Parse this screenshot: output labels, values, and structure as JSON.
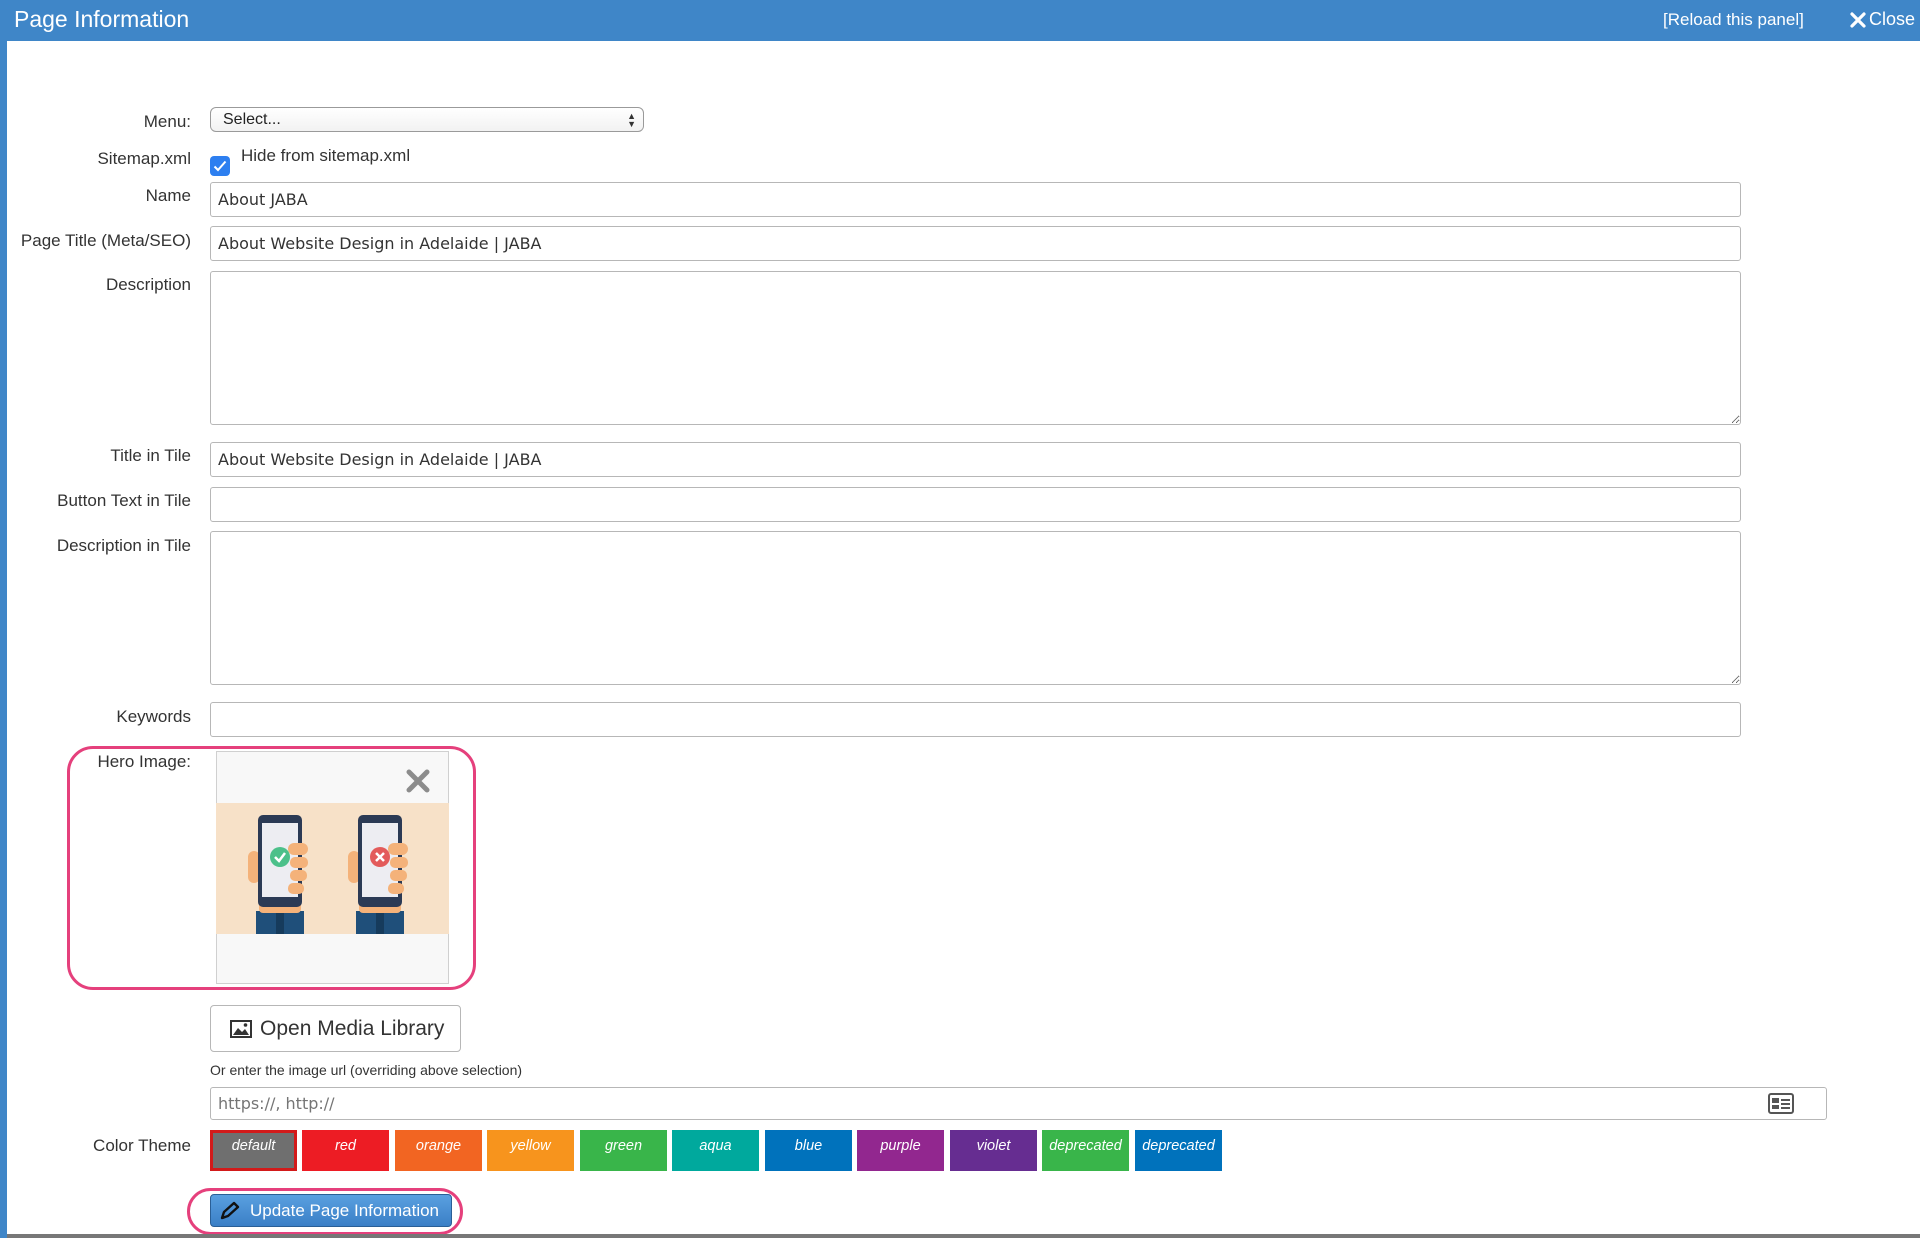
{
  "window": {
    "title": "Page Information",
    "reload_label": "[Reload this panel]",
    "close_label": "Close"
  },
  "form": {
    "menu": {
      "label": "Menu:",
      "value": "Select..."
    },
    "sitemap": {
      "label": "Sitemap.xml",
      "checkbox_label": "Hide from sitemap.xml",
      "checked": true
    },
    "name": {
      "label": "Name",
      "value": "About JABA"
    },
    "page_title": {
      "label": "Page Title (Meta/SEO)",
      "value": "About Website Design in Adelaide | JABA"
    },
    "description": {
      "label": "Description",
      "value": ""
    },
    "title_in_tile": {
      "label": "Title in Tile",
      "value": "About Website Design in Adelaide | JABA"
    },
    "button_text_in_tile": {
      "label": "Button Text in Tile",
      "value": ""
    },
    "description_in_tile": {
      "label": "Description in Tile",
      "value": ""
    },
    "keywords": {
      "label": "Keywords",
      "value": ""
    },
    "hero_image": {
      "label": "Hero Image:",
      "media_button": "Open Media Library",
      "url_note": "Or enter the image url (overriding above selection)",
      "url_placeholder": "https://, http://"
    },
    "color_theme": {
      "label": "Color Theme",
      "selected": "default",
      "options": [
        {
          "name": "default",
          "color": "#6f6f6f"
        },
        {
          "name": "red",
          "color": "#ed1c24"
        },
        {
          "name": "orange",
          "color": "#f26522"
        },
        {
          "name": "yellow",
          "color": "#f7941d"
        },
        {
          "name": "green",
          "color": "#39b54a"
        },
        {
          "name": "aqua",
          "color": "#00a99d"
        },
        {
          "name": "blue",
          "color": "#0072bc"
        },
        {
          "name": "purple",
          "color": "#92278f"
        },
        {
          "name": "violet",
          "color": "#662d91"
        },
        {
          "name": "deprecated",
          "color": "#39b54a"
        },
        {
          "name": "deprecated",
          "color": "#0072bc"
        }
      ]
    },
    "submit_label": "Update Page Information"
  },
  "colors": {
    "titlebar": "#3f86c8",
    "highlight": "#e5407c",
    "checkbox": "#2d7ff0"
  }
}
